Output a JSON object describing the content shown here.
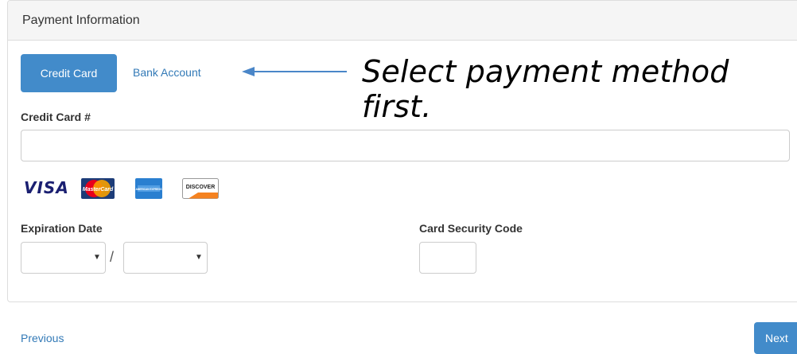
{
  "panel": {
    "title": "Payment Information"
  },
  "payment_methods": {
    "credit_card_label": "Credit Card",
    "bank_account_label": "Bank Account"
  },
  "annotation": {
    "text": "Select payment method first."
  },
  "credit_card": {
    "label": "Credit Card #",
    "value": ""
  },
  "card_logos": {
    "visa_text": "VISA",
    "mastercard_text": "MasterCard",
    "amex_text": "AMERICAN EXPRESS",
    "discover_text": "DISCOVER"
  },
  "expiration": {
    "label": "Expiration Date",
    "separator": "/",
    "month_value": "",
    "year_value": "",
    "caret": "▼"
  },
  "security_code": {
    "label": "Card Security Code",
    "value": ""
  },
  "navigation": {
    "previous_label": "Previous",
    "next_label": "Next"
  },
  "colors": {
    "primary": "#428bca",
    "link": "#337ab7",
    "heading_bg": "#f5f5f5",
    "border": "#dddddd"
  }
}
